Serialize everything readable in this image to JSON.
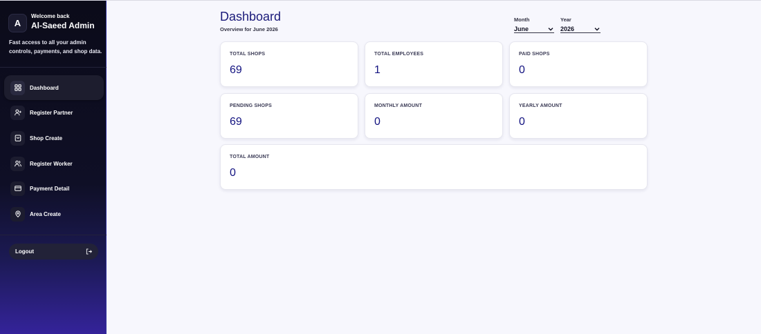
{
  "sidebar": {
    "avatar_initial": "A",
    "welcome": "Welcome back",
    "admin_name": "Al-Saeed Admin",
    "tagline": "Fast access to all your admin controls, payments, and shop data.",
    "items": [
      {
        "label": "Dashboard",
        "icon": "dashboard-grid-icon",
        "active": true
      },
      {
        "label": "Register Partner",
        "icon": "user-plus-icon",
        "active": false
      },
      {
        "label": "Shop Create",
        "icon": "shop-bag-icon",
        "active": false
      },
      {
        "label": "Register Worker",
        "icon": "users-icon",
        "active": false
      },
      {
        "label": "Payment Detail",
        "icon": "credit-card-icon",
        "active": false
      },
      {
        "label": "Area Create",
        "icon": "map-pin-icon",
        "active": false
      }
    ],
    "logout_label": "Logout",
    "logout_icon": "logout-arrow-icon"
  },
  "header": {
    "title": "Dashboard",
    "subtitle": "Overview for June 2026",
    "month": {
      "label": "Month",
      "value": "June"
    },
    "year": {
      "label": "Year",
      "value": "2026"
    }
  },
  "stats": [
    {
      "label": "TOTAL SHOPS",
      "value": "69"
    },
    {
      "label": "TOTAL EMPLOYEES",
      "value": "1"
    },
    {
      "label": "PAID SHOPS",
      "value": "0"
    },
    {
      "label": "PENDING SHOPS",
      "value": "69"
    },
    {
      "label": "MONTHLY AMOUNT",
      "value": "0"
    },
    {
      "label": "YEARLY AMOUNT",
      "value": "0"
    },
    {
      "label": "TOTAL AMOUNT",
      "value": "0"
    }
  ],
  "colors": {
    "accent": "#1b1b7a",
    "sidebar_bottom": "#34239a",
    "background": "#f7f7fd"
  }
}
